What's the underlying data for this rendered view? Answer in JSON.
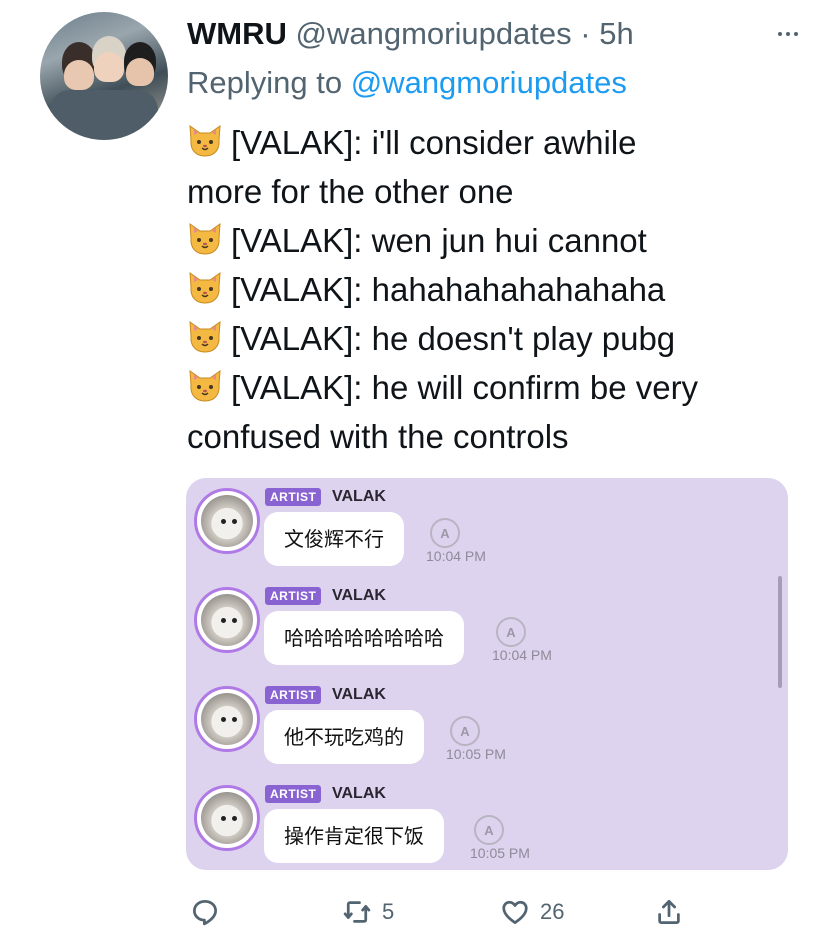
{
  "tweet": {
    "display_name": "WMRU",
    "handle": "@wangmoriupdates",
    "separator": " · ",
    "age": "5h",
    "replying_prefix": "Replying to ",
    "replying_to": "@wangmoriupdates",
    "lines": [
      "[VALAK]: i'll consider awhile",
      "more for the other one",
      "[VALAK]: wen jun hui cannot",
      "[VALAK]: hahahahahahahaha",
      "[VALAK]: he doesn't play pubg",
      "[VALAK]: he will confirm be very",
      "confused with the controls"
    ]
  },
  "media": {
    "messages": [
      {
        "badge": "ARTIST",
        "sender": "VALAK",
        "text": "文俊辉不行",
        "time": "10:04 PM"
      },
      {
        "badge": "ARTIST",
        "sender": "VALAK",
        "text": "哈哈哈哈哈哈哈哈",
        "time": "10:04 PM"
      },
      {
        "badge": "ARTIST",
        "sender": "VALAK",
        "text": "他不玩吃鸡的",
        "time": "10:05 PM"
      },
      {
        "badge": "ARTIST",
        "sender": "VALAK",
        "text": "操作肯定很下饭",
        "time": "10:05 PM"
      }
    ]
  },
  "actions": {
    "reply_count": "",
    "retweet_count": "5",
    "like_count": "26"
  },
  "icons": {
    "emoji": "cat-face-icon",
    "more": "more-dots-icon",
    "translate": "translate-icon"
  },
  "colors": {
    "mention": "#1d9bf0",
    "secondary_text": "#536471",
    "media_bg": "#ddd3ee",
    "badge": "#8a63d2"
  }
}
